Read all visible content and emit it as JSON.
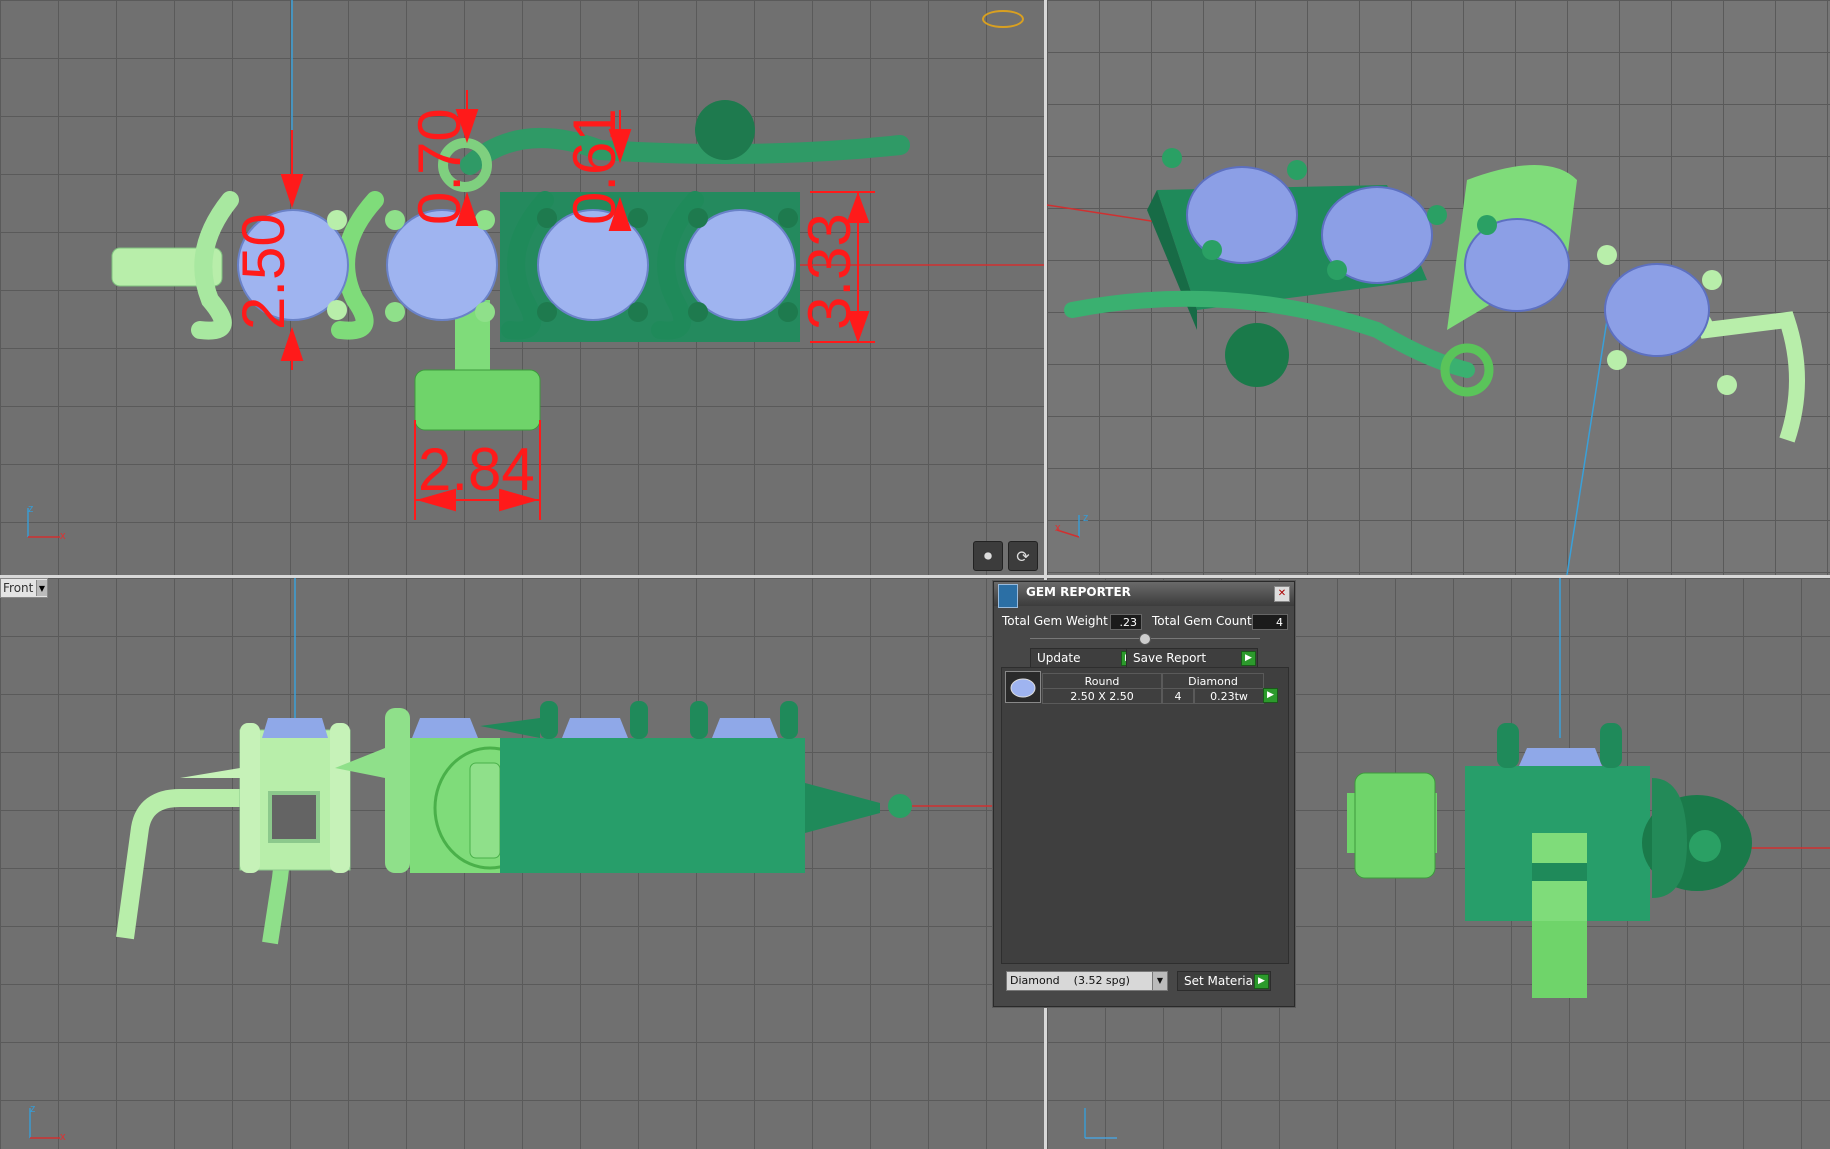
{
  "viewport_top": {
    "dimensions": {
      "d1": "2.50",
      "d2": "0.70",
      "d3": "0.61",
      "d4": "3.33",
      "d5": "2.84"
    },
    "axis": {
      "x": "x",
      "z": "z"
    }
  },
  "viewport_persp": {
    "axis": {
      "x": "x",
      "z": "z"
    }
  },
  "viewport_front": {
    "view_label": "Front",
    "axis": {
      "x": "x",
      "z": "z"
    }
  },
  "gem_reporter": {
    "title": "GEM REPORTER",
    "total_weight_label": "Total Gem Weight",
    "total_weight_value": ".23",
    "total_count_label": "Total Gem Count",
    "total_count_value": "4",
    "update_label": "Update",
    "save_report_label": "Save Report",
    "table": {
      "headers": [
        "Round",
        "Diamond"
      ],
      "rows": [
        {
          "size": "2.50 X 2.50",
          "count": "4",
          "weight": "0.23tw"
        }
      ]
    },
    "material_select": "Diamond    (3.52 spg)",
    "set_material_label": "Set Material"
  },
  "colors": {
    "dimension": "#ff1a1a",
    "metal_dark": "#1f8a5a",
    "metal_light": "#9be59b",
    "gem": "#9fb4f0"
  }
}
